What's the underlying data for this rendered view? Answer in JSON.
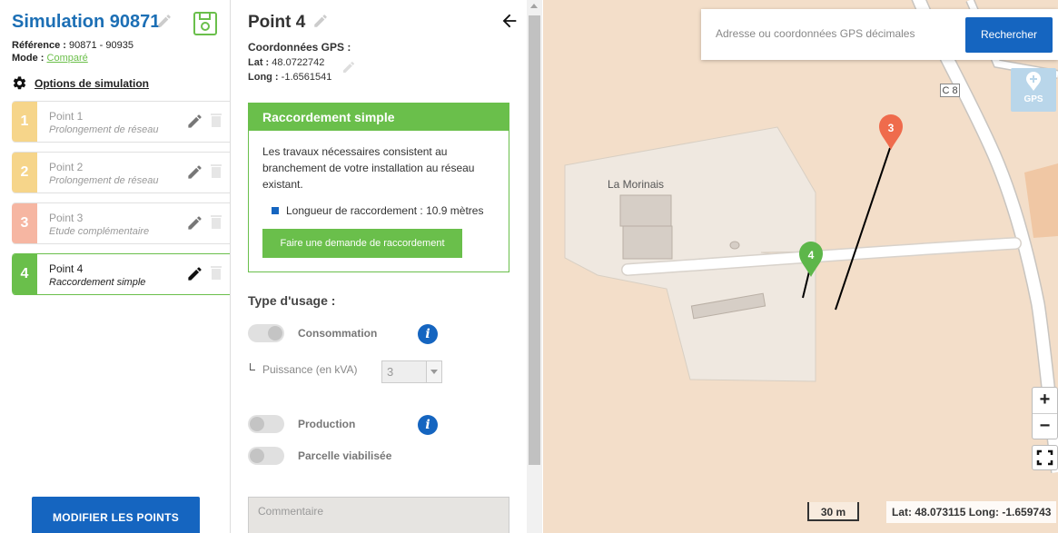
{
  "sidebar": {
    "title": "Simulation 90871",
    "reference_label": "Référence :",
    "reference_value": " 90871 - 90935",
    "mode_label": "Mode :",
    "mode_value": "Comparé",
    "options_label": "Options de simulation",
    "points": [
      {
        "number": "1",
        "name": "Point 1",
        "type": "Prolongement de réseau",
        "color": "#f6d58a"
      },
      {
        "number": "2",
        "name": "Point 2",
        "type": "Prolongement de réseau",
        "color": "#f6d58a"
      },
      {
        "number": "3",
        "name": "Point 3",
        "type": "Etude complémentaire",
        "color": "#f6b6a2"
      },
      {
        "number": "4",
        "name": "Point 4",
        "type": "Raccordement simple",
        "color": "#6abf4b"
      }
    ],
    "modify_button": "MODIFIER LES POINTS"
  },
  "detail": {
    "title": "Point 4",
    "gps_heading": "Coordonnées GPS :",
    "lat_label": "Lat :",
    "lat_value": " 48.0722742",
    "long_label": "Long :",
    "long_value": " -1.6561541",
    "raccordement": {
      "heading": "Raccordement simple",
      "description": "Les travaux nécessaires consistent au branchement de votre installation au réseau existant.",
      "length": "Longueur de raccordement : 10.9 mètres",
      "button": "Faire une demande de raccordement"
    },
    "usage_heading": "Type d'usage :",
    "consommation_label": "Consommation",
    "puissance_label": "Puissance (en kVA)",
    "puissance_value": "3",
    "production_label": "Production",
    "parcelle_label": "Parcelle viabilisée",
    "comment_placeholder": "Commentaire"
  },
  "map": {
    "search_placeholder": "Adresse ou coordonnées GPS décimales",
    "search_button": "Rechercher",
    "gps_button": "GPS",
    "zoom_in": "+",
    "zoom_out": "−",
    "scale_label": "30 m",
    "coord_readout": "Lat: 48.073115 Long: -1.659743",
    "place_label": "La Morinais",
    "road_label": "C 8",
    "marker_3": "3",
    "marker_4": "4",
    "colors": {
      "accent": "#1565c0",
      "green": "#6abf4b",
      "marker_red": "#ef6b4c"
    }
  },
  "icons": [
    "pencil-icon",
    "save-icon",
    "gear-icon",
    "trash-icon",
    "back-arrow-icon",
    "info-icon",
    "gps-pin-icon",
    "fullscreen-icon"
  ]
}
